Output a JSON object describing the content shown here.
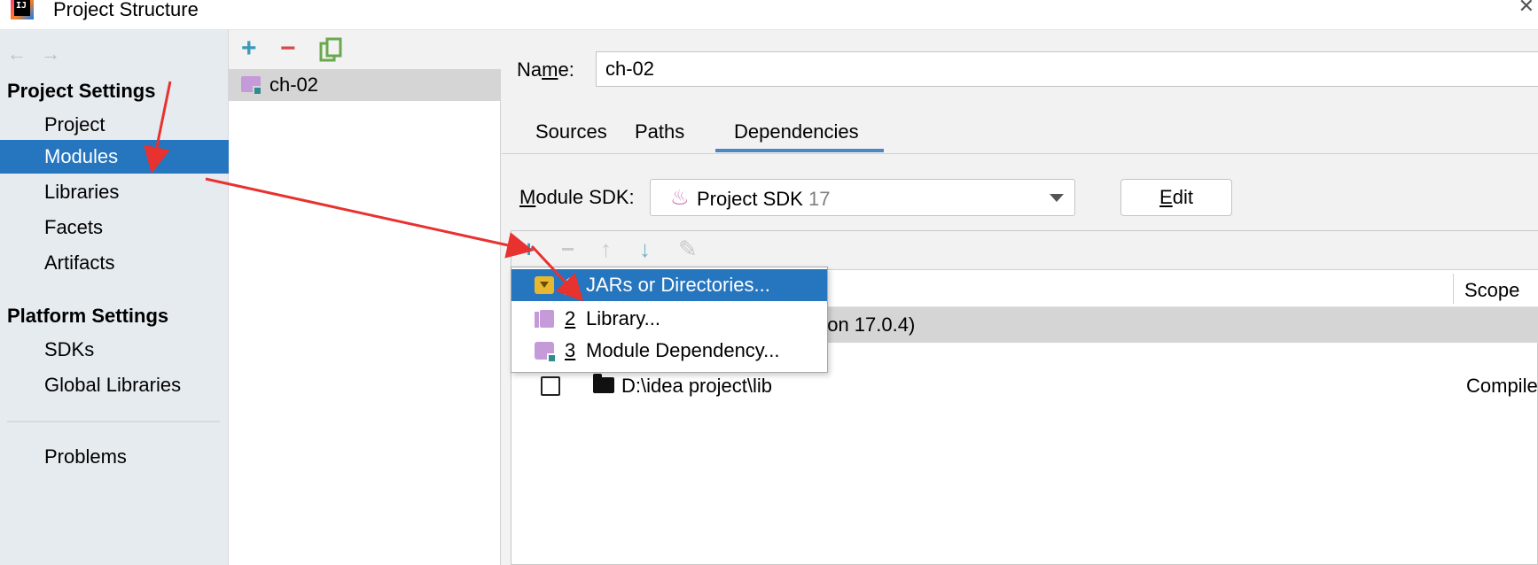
{
  "window": {
    "title": "Project Structure",
    "logo_text": "IJ",
    "close_glyph": "✕"
  },
  "nav": {
    "back_glyph": "←",
    "forward_glyph": "→"
  },
  "sidebar": {
    "project_settings_header": "Project Settings",
    "platform_settings_header": "Platform Settings",
    "items": [
      {
        "label": "Project"
      },
      {
        "label": "Modules"
      },
      {
        "label": "Libraries"
      },
      {
        "label": "Facets"
      },
      {
        "label": "Artifacts"
      },
      {
        "label": "SDKs"
      },
      {
        "label": "Global Libraries"
      },
      {
        "label": "Problems"
      }
    ],
    "selected": "Modules"
  },
  "modules_toolbar": {
    "add_glyph": "+",
    "remove_glyph": "−"
  },
  "modules": [
    {
      "name": "ch-02"
    }
  ],
  "module_detail": {
    "name_label_pre": "Na",
    "name_label_u": "m",
    "name_label_post": "e:",
    "name_value": "ch-02",
    "tabs": [
      {
        "label": "Sources"
      },
      {
        "label": "Paths"
      },
      {
        "label": "Dependencies"
      }
    ],
    "active_tab": "Dependencies",
    "sdk_label_u": "M",
    "sdk_label_post": "odule SDK:",
    "sdk_value": "Project SDK",
    "sdk_version": "17",
    "edit_label_u": "E",
    "edit_label_post": "dit"
  },
  "deps_toolbar": {
    "add_glyph": "+",
    "remove_glyph": "−",
    "up_glyph": "↑",
    "down_glyph": "↓",
    "edit_glyph": "✎"
  },
  "dependencies": {
    "scope_header": "Scope",
    "sdk_row_text": "rsion 17.0.4)",
    "rows": [
      {
        "path": "D:\\idea project\\lib",
        "scope": "Compile"
      }
    ]
  },
  "popup_menu": {
    "items": [
      {
        "num": "1",
        "label": "JARs or Directories..."
      },
      {
        "num": "2",
        "label": "Library..."
      },
      {
        "num": "3",
        "label": "Module Dependency..."
      }
    ],
    "selected": "JARs or Directories..."
  },
  "colors": {
    "selection": "#2675bf",
    "annotation_red": "#e8322f",
    "module_purple": "#c59ad8"
  }
}
